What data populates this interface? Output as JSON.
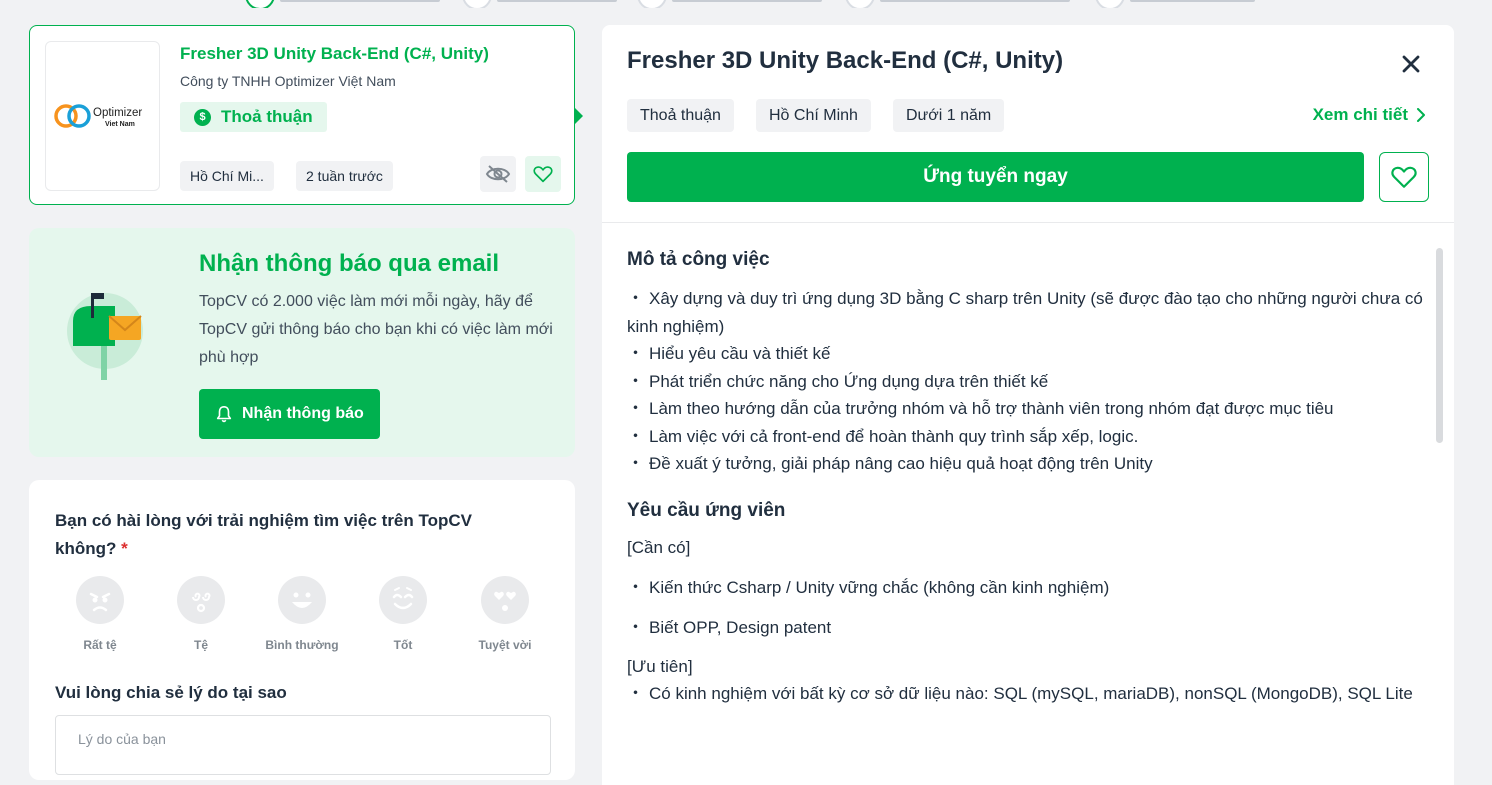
{
  "job_card": {
    "title": "Fresher 3D Unity Back-End (C#, Unity)",
    "company": "Công ty TNHH Optimizer Việt Nam",
    "logo_text": "Optimizer",
    "logo_subtext": "Viet Nam",
    "salary": "Thoả thuận",
    "location": "Hồ Chí Mi...",
    "posted": "2 tuần trước",
    "icons": {
      "hide": "eye-off-icon",
      "save": "heart-icon",
      "salary": "dollar-icon"
    }
  },
  "email_alert": {
    "title": "Nhận thông báo qua email",
    "description": "TopCV có 2.000 việc làm mới mỗi ngày, hãy để TopCV gửi thông báo cho bạn khi có việc làm mới phù hợp",
    "button_label": "Nhận thông báo",
    "icon": "bell-icon"
  },
  "feedback": {
    "question": "Bạn có hài lòng với trải nghiệm tìm việc trên TopCV không?",
    "required_mark": "*",
    "ratings": [
      {
        "label": "Rất tệ",
        "icon": "angry-face-icon"
      },
      {
        "label": "Tệ",
        "icon": "dizzy-face-icon"
      },
      {
        "label": "Bình thường",
        "icon": "smiling-face-icon"
      },
      {
        "label": "Tốt",
        "icon": "happy-face-icon"
      },
      {
        "label": "Tuyệt vời",
        "icon": "heart-eyes-face-icon"
      }
    ],
    "reason_label": "Vui lòng chia sẻ lý do tại sao",
    "reason_placeholder": "Lý do của bạn"
  },
  "detail": {
    "title": "Fresher 3D Unity Back-End (C#, Unity)",
    "tags": [
      "Thoả thuận",
      "Hồ Chí Minh",
      "Dưới 1 năm"
    ],
    "view_detail": "Xem chi tiết",
    "apply_label": "Ứng tuyển ngay",
    "sections": {
      "description_title": "Mô tả công việc",
      "description_items": [
        "Xây dựng và duy trì ứng dụng 3D bằng C sharp trên Unity (sẽ được đào tạo cho những người chưa có kinh nghiệm)",
        "Hiểu yêu cầu và thiết kế",
        "Phát triển chức năng cho Ứng dụng dựa trên thiết kế",
        "Làm theo hướng dẫn của trưởng nhóm và hỗ trợ thành viên trong nhóm đạt được mục tiêu",
        "Làm việc với cả front-end để hoàn thành quy trình sắp xếp, logic.",
        "Đề xuất ý tưởng, giải pháp nâng cao hiệu quả hoạt động trên Unity"
      ],
      "requirements_title": "Yêu cầu ứng viên",
      "required_label": "[Cần có]",
      "required_items": [
        "Kiến thức Csharp / Unity vững chắc (không cần kinh nghiệm)",
        "Biết OPP, Design patent"
      ],
      "preferred_label": "[Ưu tiên]",
      "preferred_items": [
        "Có kinh nghiệm với bất kỳ cơ sở dữ liệu nào: SQL (mySQL, mariaDB), nonSQL (MongoDB), SQL Lite"
      ]
    }
  },
  "colors": {
    "brand": "#00b14f",
    "brand_light": "#e5f7ed",
    "text": "#212f3f"
  }
}
